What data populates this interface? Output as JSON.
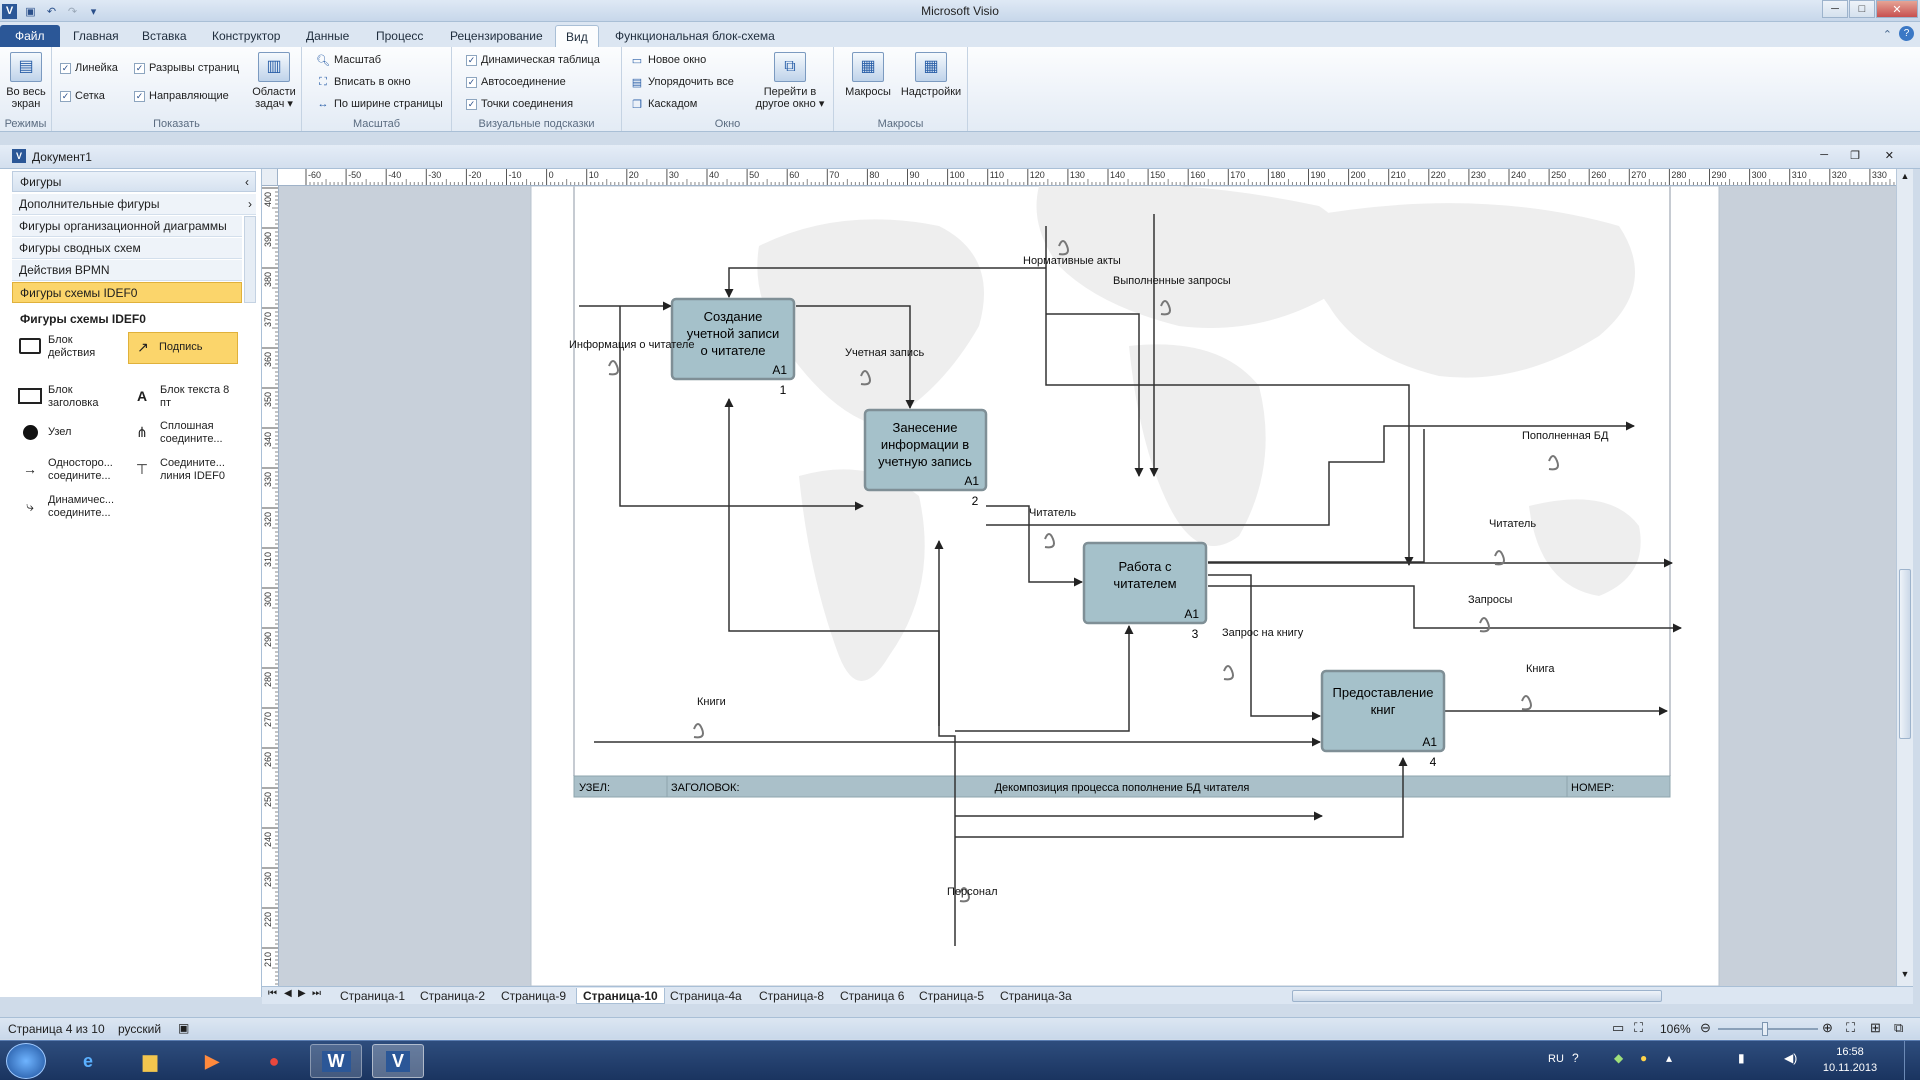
{
  "window": {
    "title": "Microsoft Visio"
  },
  "qat": {
    "app_icon": "V"
  },
  "tabs": [
    {
      "label": "Файл"
    },
    {
      "label": "Главная"
    },
    {
      "label": "Вставка"
    },
    {
      "label": "Конструктор"
    },
    {
      "label": "Данные"
    },
    {
      "label": "Процесс"
    },
    {
      "label": "Рецензирование"
    },
    {
      "label": "Вид"
    },
    {
      "label": "Функциональная блок-схема"
    }
  ],
  "ribbon": {
    "modes": {
      "fullscreen": "Во весь экран",
      "label": "Режимы"
    },
    "show": {
      "ruler": "Линейка",
      "page_breaks": "Разрывы страниц",
      "grid": "Сетка",
      "guides": "Направляющие",
      "task_panes": "Области задач",
      "label": "Показать"
    },
    "zoom": {
      "zoom": "Масштаб",
      "fit_window": "Вписать в окно",
      "page_width": "По ширине страницы",
      "label": "Масштаб"
    },
    "visual": {
      "dynamic_grid": "Динамическая таблица",
      "autoconnect": "Автосоединение",
      "connection_points": "Точки соединения",
      "label": "Визуальные подсказки"
    },
    "window": {
      "new_window": "Новое окно",
      "arrange_all": "Упорядочить все",
      "cascade": "Каскадом",
      "switch": "Перейти в другое окно",
      "label": "Окно"
    },
    "macros": {
      "macros": "Макросы",
      "addins": "Надстройки",
      "label": "Макросы"
    }
  },
  "document": {
    "title": "Документ1"
  },
  "shapes_panel": {
    "title": "Фигуры",
    "more_shapes": "Дополнительные фигуры",
    "stencils": [
      "Фигуры организационной диаграммы",
      "Фигуры сводных схем",
      "Действия BPMN",
      "Фигуры схемы IDEF0"
    ],
    "stencil_title": "Фигуры схемы IDEF0",
    "items": [
      {
        "label": "Блок действия"
      },
      {
        "label": "Подпись"
      },
      {
        "label": "Блок заголовка"
      },
      {
        "label": "Блок текста 8 пт"
      },
      {
        "label": "Узел"
      },
      {
        "label": "Сплошная соедините..."
      },
      {
        "label": "Односторо... соедините..."
      },
      {
        "label": "Соедините... линия IDEF0"
      },
      {
        "label": "Динамичес... соедините..."
      }
    ]
  },
  "ruler": {
    "h_ticks": [
      "-60",
      "-50",
      "-40",
      "-30",
      "-20",
      "-10",
      "0",
      "10",
      "20",
      "30",
      "40",
      "50",
      "60",
      "70",
      "80",
      "90",
      "100",
      "110",
      "120",
      "130",
      "140",
      "150",
      "160",
      "170",
      "180",
      "190",
      "200",
      "210",
      "220",
      "230",
      "240",
      "250",
      "260",
      "270",
      "280",
      "290",
      "300",
      "310",
      "320",
      "330"
    ],
    "v_ticks": [
      "400",
      "390",
      "380",
      "370",
      "360",
      "350",
      "340",
      "330",
      "320",
      "310",
      "300",
      "290",
      "280",
      "270",
      "260",
      "250",
      "240",
      "230",
      "220",
      "210"
    ]
  },
  "diagram": {
    "boxes": [
      {
        "text": "Создание учетной записи о читателе",
        "code": "A1",
        "num": "1"
      },
      {
        "text": "Занесение информации в учетную запись",
        "code": "A1",
        "num": "2"
      },
      {
        "text": "Работа с читателем",
        "code": "A1",
        "num": "3"
      },
      {
        "text": "Предоставление книг",
        "code": "A1",
        "num": "4"
      }
    ],
    "labels": [
      "Нормативные акты",
      "Выполненные запросы",
      "Информация о читателе",
      "Учетная запись",
      "Пополненная БД",
      "Читатель",
      "Читатель",
      "Запросы",
      "Запрос на книгу",
      "Книги",
      "Книга",
      "Персонал"
    ],
    "footer": {
      "node": "УЗЕЛ:",
      "title_label": "ЗАГОЛОВОК:",
      "title": "Декомпозиция процесса пополнение БД читателя",
      "number": "НОМЕР:"
    }
  },
  "page_tabs": [
    "Страница-1",
    "Страница-2",
    "Страница-9",
    "Страница-10",
    "Страница-4а",
    "Страница-8",
    "Страница 6",
    "Страница-5",
    "Страница-3а"
  ],
  "active_page": "Страница-10",
  "status": {
    "page": "Страница 4 из 10",
    "language": "русский",
    "zoom": "106%"
  },
  "taskbar": {
    "lang": "RU",
    "time": "16:58",
    "date": "10.11.2013"
  }
}
